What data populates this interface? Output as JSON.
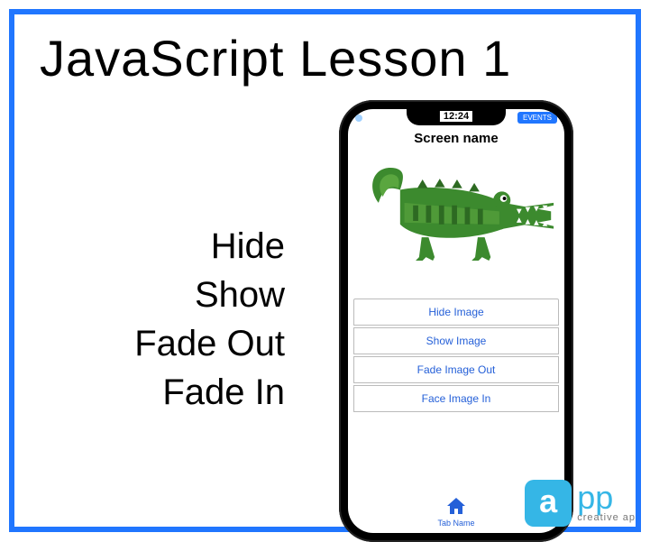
{
  "title": "JavaScript Lesson 1",
  "actions": [
    "Hide",
    "Show",
    "Fade Out",
    "Fade In"
  ],
  "phone": {
    "time": "12:24",
    "events_label": "EVENTS",
    "screen_title": "Screen name",
    "buttons": [
      "Hide Image",
      "Show Image",
      "Fade Image Out",
      "Face Image In"
    ],
    "tab_label": "Tab Name"
  },
  "brand": {
    "letter": "a",
    "rest": "pp",
    "tagline": "creative ap"
  }
}
